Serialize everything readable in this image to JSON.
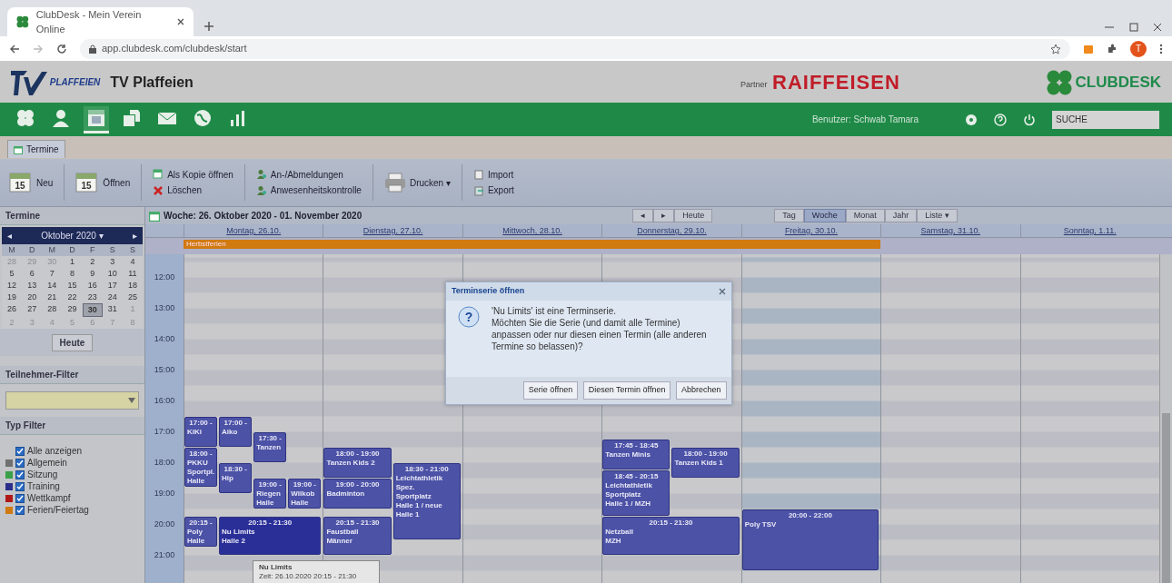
{
  "browser": {
    "tab_title": "ClubDesk - Mein Verein Online",
    "url": "app.clubdesk.com/clubdesk/start",
    "profile": "T"
  },
  "header": {
    "club_name": "TV Plaffeien",
    "logo_text": "PLAFFEIEN",
    "partner_label": "Partner",
    "partner_name": "RAIFFEISEN",
    "brand": "CLUBDESK"
  },
  "nav": [
    {
      "kind": "clover",
      "selected": false
    },
    {
      "kind": "person",
      "selected": false
    },
    {
      "kind": "calendar",
      "selected": true
    },
    {
      "kind": "documents",
      "selected": false
    },
    {
      "kind": "envelope",
      "selected": false
    },
    {
      "kind": "globe",
      "selected": false
    },
    {
      "kind": "chart",
      "selected": false
    }
  ],
  "user": "Benutzer: Schwab Tamara",
  "search": {
    "value": "SUCHE"
  },
  "module_tab": "Termine",
  "toolbar": [
    {
      "kind": "big",
      "label": "Neu",
      "badge": "15"
    },
    {
      "kind": "big",
      "label": "Öffnen",
      "badge": "15"
    },
    {
      "kind": "pair",
      "items": [
        {
          "label": "Als Kopie öffnen"
        },
        {
          "label": "Löschen"
        }
      ]
    },
    {
      "kind": "pair",
      "items": [
        {
          "label": "An-/Abmeldungen"
        },
        {
          "label": "Anwesenheitskontrolle"
        }
      ]
    },
    {
      "kind": "print",
      "label": "Drucken ▾"
    },
    {
      "kind": "pair",
      "items": [
        {
          "label": "Import"
        },
        {
          "label": "Export"
        }
      ]
    }
  ],
  "sidebar": {
    "title": "Termine",
    "month": "Oktober 2020 ▾",
    "prev": "◂",
    "next": "▸",
    "weekdays": [
      "M",
      "D",
      "M",
      "D",
      "F",
      "S",
      "S"
    ],
    "weeks": [
      [
        {
          "day": "28",
          "other_month": true,
          "selected": false
        },
        {
          "day": "29",
          "other_month": true,
          "selected": false
        },
        {
          "day": "30",
          "other_month": true,
          "selected": false
        },
        {
          "day": "1",
          "other_month": false,
          "selected": false
        },
        {
          "day": "2",
          "other_month": false,
          "selected": false
        },
        {
          "day": "3",
          "other_month": false,
          "selected": false
        },
        {
          "day": "4",
          "other_month": false,
          "selected": false
        }
      ],
      [
        {
          "day": "5",
          "other_month": false,
          "selected": false
        },
        {
          "day": "6",
          "other_month": false,
          "selected": false
        },
        {
          "day": "7",
          "other_month": false,
          "selected": false
        },
        {
          "day": "8",
          "other_month": false,
          "selected": false
        },
        {
          "day": "9",
          "other_month": false,
          "selected": false
        },
        {
          "day": "10",
          "other_month": false,
          "selected": false
        },
        {
          "day": "11",
          "other_month": false,
          "selected": false
        }
      ],
      [
        {
          "day": "12",
          "other_month": false,
          "selected": false
        },
        {
          "day": "13",
          "other_month": false,
          "selected": false
        },
        {
          "day": "14",
          "other_month": false,
          "selected": false
        },
        {
          "day": "15",
          "other_month": false,
          "selected": false
        },
        {
          "day": "16",
          "other_month": false,
          "selected": false
        },
        {
          "day": "17",
          "other_month": false,
          "selected": false
        },
        {
          "day": "18",
          "other_month": false,
          "selected": false
        }
      ],
      [
        {
          "day": "19",
          "other_month": false,
          "selected": false
        },
        {
          "day": "20",
          "other_month": false,
          "selected": false
        },
        {
          "day": "21",
          "other_month": false,
          "selected": false
        },
        {
          "day": "22",
          "other_month": false,
          "selected": false
        },
        {
          "day": "23",
          "other_month": false,
          "selected": false
        },
        {
          "day": "24",
          "other_month": false,
          "selected": false
        },
        {
          "day": "25",
          "other_month": false,
          "selected": false
        }
      ],
      [
        {
          "day": "26",
          "other_month": false,
          "selected": false
        },
        {
          "day": "27",
          "other_month": false,
          "selected": false
        },
        {
          "day": "28",
          "other_month": false,
          "selected": false
        },
        {
          "day": "29",
          "other_month": false,
          "selected": false
        },
        {
          "day": "30",
          "other_month": false,
          "selected": true
        },
        {
          "day": "31",
          "other_month": false,
          "selected": false
        },
        {
          "day": "1",
          "other_month": true,
          "selected": false
        }
      ],
      [
        {
          "day": "2",
          "other_month": true,
          "selected": false
        },
        {
          "day": "3",
          "other_month": true,
          "selected": false
        },
        {
          "day": "4",
          "other_month": true,
          "selected": false
        },
        {
          "day": "5",
          "other_month": true,
          "selected": false
        },
        {
          "day": "6",
          "other_month": true,
          "selected": false
        },
        {
          "day": "7",
          "other_month": true,
          "selected": false
        },
        {
          "day": "8",
          "other_month": true,
          "selected": false
        }
      ]
    ],
    "today_button": "Heute",
    "participant_filter": "Teilnehmer-Filter",
    "type_filter": "Typ Filter",
    "types": [
      {
        "label": "Alle anzeigen",
        "checked": true
      },
      {
        "label": "Allgemein",
        "checked": true,
        "color": "#707070"
      },
      {
        "label": "Sitzung",
        "checked": true,
        "color": "#3aa04a"
      },
      {
        "label": "Training",
        "checked": true,
        "color": "#2c2f8a"
      },
      {
        "label": "Wettkampf",
        "checked": true,
        "color": "#b01818"
      },
      {
        "label": "Ferien/Feiertag",
        "checked": true,
        "color": "#d07a10"
      }
    ]
  },
  "week_title": "Woche: 26. Oktober 2020 - 01. November 2020",
  "week_nav": [
    "◂",
    "▸",
    "Heute"
  ],
  "views": [
    {
      "label": "Tag",
      "selected": false
    },
    {
      "label": "Woche",
      "selected": true
    },
    {
      "label": "Monat",
      "selected": false
    },
    {
      "label": "Jahr",
      "selected": false
    },
    {
      "label": "Liste ▾",
      "selected": false
    }
  ],
  "hours": [
    "12:00",
    "13:00",
    "14:00",
    "15:00",
    "16:00",
    "17:00",
    "18:00",
    "19:00",
    "20:00",
    "21:00"
  ],
  "days": [
    {
      "label": "Montag, 26.10.",
      "selected": false,
      "all_day": {
        "title": "Herbstferien",
        "color": "#d07a10"
      },
      "lanes": [
        [
          {
            "time": "17:00 -",
            "lines": [
              "KiKi"
            ],
            "selected": false
          },
          {
            "time": "18:00 -",
            "lines": [
              "PKKU",
              "Sportpl.",
              "Halle"
            ],
            "selected": false
          },
          {
            "time": "20:15 -",
            "lines": [
              "Poly",
              "Halle"
            ],
            "selected": false
          }
        ],
        [
          {
            "time": "17:00 -",
            "lines": [
              "Aiko"
            ],
            "selected": false
          },
          {
            "time": "18:30 -",
            "lines": [
              "Hip"
            ],
            "selected": false
          },
          {
            "time": "20:15 - 21:30",
            "lines": [
              "Nu Limits",
              "Halle 2"
            ],
            "selected": true,
            "wide": true
          }
        ],
        [
          {
            "time": "17:30 -",
            "lines": [
              "Tanzen"
            ],
            "selected": false
          },
          {
            "time": "19:00 -",
            "lines": [
              "Riegen",
              "Halle"
            ],
            "selected": false
          }
        ],
        [
          {
            "time": "19:00 -",
            "lines": [
              "Wilkob",
              "Halle"
            ],
            "selected": false
          }
        ]
      ]
    },
    {
      "label": "Dienstag, 27.10.",
      "selected": false,
      "all_day_continues": true,
      "lanes": [
        [
          {
            "time": "18:00 - 19:00",
            "lines": [
              "Tanzen Kids 2"
            ],
            "selected": false
          },
          {
            "time": "19:00 - 20:00",
            "lines": [
              "Badminton"
            ],
            "selected": false
          },
          {
            "time": "20:15 - 21:30",
            "lines": [
              "Faustball",
              "Männer"
            ],
            "selected": false
          }
        ],
        [
          {
            "time": "18:30 - 21:00",
            "lines": [
              "Leichtathletik",
              "Spez.",
              "Sportplatz",
              "Halle 1 / neue",
              "Halle 1"
            ],
            "selected": false
          }
        ]
      ]
    },
    {
      "label": "Mittwoch, 28.10.",
      "selected": false,
      "all_day_continues": true
    },
    {
      "label": "Donnerstag, 29.10.",
      "selected": false,
      "all_day_continues": true,
      "lanes": [
        [
          {
            "time": "17:45 - 18:45",
            "lines": [
              "Tanzen Minis"
            ],
            "selected": false
          },
          {
            "time": "18:45 - 20:15",
            "lines": [
              "Leichtathletik",
              "Sportplatz",
              "Halle 1 / MZH"
            ],
            "selected": false
          },
          {
            "time": "20:15 - 21:30",
            "lines": [
              "Netzball",
              "MZH"
            ],
            "selected": false,
            "wide": true
          }
        ],
        [
          {
            "time": "18:00 - 19:00",
            "lines": [
              "Tanzen Kids 1"
            ],
            "selected": false
          }
        ]
      ]
    },
    {
      "label": "Freitag, 30.10.",
      "selected": true,
      "all_day_continues": true,
      "lanes": [
        [
          {
            "time": "20:00 - 22:00",
            "lines": [
              "Poly TSV"
            ],
            "selected": false
          }
        ]
      ]
    },
    {
      "label": "Samstag, 31.10.",
      "selected": false
    },
    {
      "label": "Sonntag, 1.11.",
      "selected": false
    }
  ],
  "tooltip": {
    "title": "Nu Limits",
    "text": "Zeit: 26.10.2020 20:15 - 21:30"
  },
  "dialog": {
    "title": "Terminserie öffnen",
    "icon": "?",
    "message": "'Nu Limits' ist eine Terminserie.\nMöchten Sie die Serie (und damit alle Termine) anpassen oder nur diesen einen Termin (alle anderen Termine so belassen)?",
    "buttons": [
      "Serie öffnen",
      "Diesen Termin öffnen",
      "Abbrechen"
    ]
  }
}
